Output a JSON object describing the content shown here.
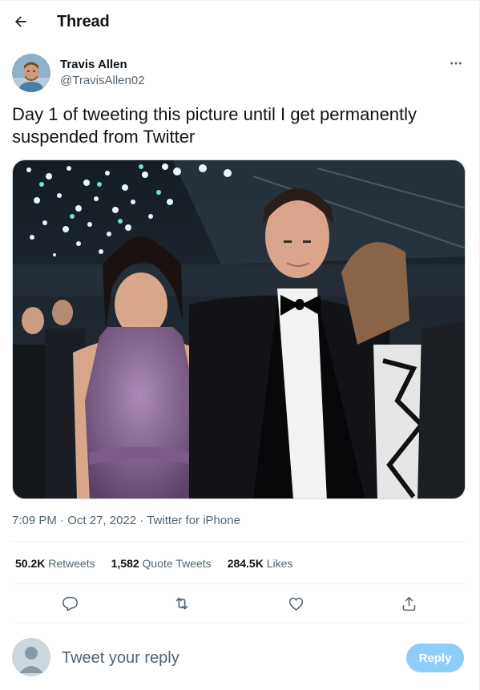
{
  "header": {
    "title": "Thread"
  },
  "tweet": {
    "author_name": "Travis Allen",
    "author_handle": "@TravisAllen02",
    "text": "Day 1 of tweeting this picture until I get permanently suspended from Twitter",
    "time": "7:09 PM",
    "date": "Oct 27, 2022",
    "source": "Twitter for iPhone",
    "separator": " · "
  },
  "stats": [
    {
      "count": "50.2K",
      "label": "Retweets"
    },
    {
      "count": "1,582",
      "label": "Quote Tweets"
    },
    {
      "count": "284.5K",
      "label": "Likes"
    }
  ],
  "reply": {
    "placeholder": "Tweet your reply",
    "button_label": "Reply"
  },
  "icons": {
    "back": "arrow-left-icon",
    "more": "more-horizontal-icon",
    "reply": "comment-icon",
    "retweet": "retweet-icon",
    "like": "heart-icon",
    "share": "share-icon"
  },
  "colors": {
    "accent": "#1d9bf0",
    "reply_button_disabled": "#8ecdf8",
    "secondary_text": "#536471",
    "divider": "#eff3f4"
  }
}
